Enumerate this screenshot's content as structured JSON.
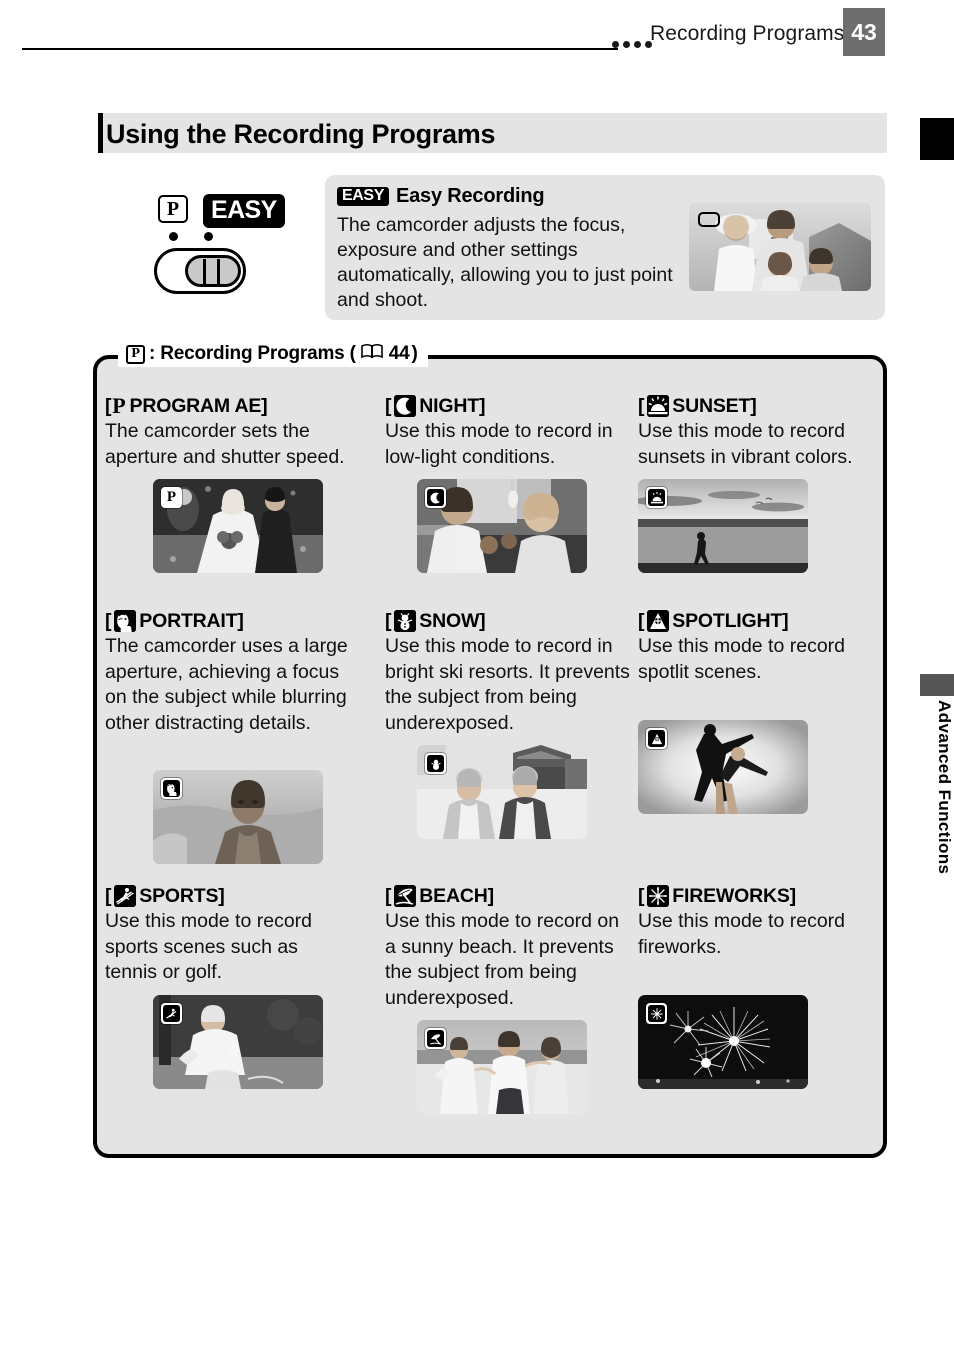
{
  "header": {
    "title": "Recording Programs",
    "page_number": "43",
    "dots_icon": "four-dots-icon"
  },
  "side_tab": {
    "label": "Advanced Functions"
  },
  "section": {
    "title": "Using the Recording Programs"
  },
  "easy_recording": {
    "chip_label": "EASY",
    "heading": "Easy Recording",
    "body": "The camcorder adjusts the focus, exposure and other settings automatically, allowing you to just point and shoot.",
    "photo_alt": "family-on-beach-photo",
    "photo_badge_icon": "easy-rounded-rect-icon"
  },
  "mode_switch": {
    "p_label": "P",
    "easy_label": "EASY",
    "switch_icon": "mode-slider-switch-icon"
  },
  "programs_box": {
    "legend_p": "P",
    "legend_text": ": Recording Programs (",
    "legend_book_icon": "open-book-icon",
    "legend_page": "44",
    "legend_close": ")"
  },
  "programs": [
    {
      "id": "program-ae",
      "icon": "letter-p-icon",
      "open_bracket": "[",
      "label": "PROGRAM AE]",
      "description": "The camcorder sets the aperture and shutter speed.",
      "photo_alt": "wedding-couple-photo",
      "badge_icon": "letter-p-badge-icon"
    },
    {
      "id": "night",
      "icon": "crescent-moon-icon",
      "open_bracket": "[",
      "label": "NIGHT]",
      "description": "Use this mode to record in low-light conditions.",
      "photo_alt": "couple-in-dim-bar-photo",
      "badge_icon": "crescent-moon-badge-icon"
    },
    {
      "id": "sunset",
      "icon": "setting-sun-icon",
      "open_bracket": "[",
      "label": "SUNSET]",
      "description": "Use this mode to record sunsets in vibrant colors.",
      "photo_alt": "sunset-walker-silhouette-photo",
      "badge_icon": "setting-sun-badge-icon"
    },
    {
      "id": "portrait",
      "icon": "face-portrait-icon",
      "open_bracket": "[",
      "label": "PORTRAIT]",
      "description": "The camcorder uses a large aperture, achieving a focus on the subject while blurring other distracting details.",
      "photo_alt": "young-man-outdoors-photo",
      "badge_icon": "face-portrait-badge-icon"
    },
    {
      "id": "snow",
      "icon": "snowman-icon",
      "open_bracket": "[",
      "label": "SNOW]",
      "description": "Use this mode to record in bright ski resorts. It prevents the subject from being underexposed.",
      "photo_alt": "two-children-in-snow-photo",
      "badge_icon": "snowman-badge-icon"
    },
    {
      "id": "spotlight",
      "icon": "spotlight-cone-icon",
      "open_bracket": "[",
      "label": "SPOTLIGHT]",
      "description": "Use this mode to record spotlit scenes.",
      "photo_alt": "dancers-in-spotlight-photo",
      "badge_icon": "spotlight-cone-badge-icon"
    },
    {
      "id": "sports",
      "icon": "skier-sports-icon",
      "open_bracket": "[",
      "label": "SPORTS]",
      "description": "Use this mode to record sports scenes such as tennis or golf.",
      "photo_alt": "tennis-player-photo",
      "badge_icon": "skier-sports-badge-icon"
    },
    {
      "id": "beach",
      "icon": "beach-parasol-icon",
      "open_bracket": "[",
      "label": "BEACH]",
      "description": "Use this mode to record on a sunny beach. It prevents the subject from being underexposed.",
      "photo_alt": "children-running-on-beach-photo",
      "badge_icon": "beach-parasol-badge-icon"
    },
    {
      "id": "fireworks",
      "icon": "fireworks-burst-icon",
      "open_bracket": "[",
      "label": "FIREWORKS]",
      "description": "Use this mode to record fireworks.",
      "photo_alt": "fireworks-night-sky-photo",
      "badge_icon": "fireworks-burst-badge-icon"
    }
  ],
  "colors": {
    "panel_gray": "#e4e4e4",
    "page_tab_gray": "#6e6e6e",
    "ink": "#000000"
  }
}
